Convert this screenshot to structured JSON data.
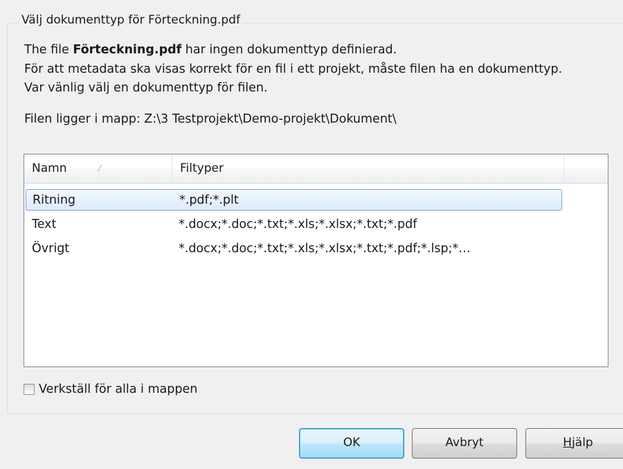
{
  "group": {
    "title": "Välj dokumenttyp för Förteckning.pdf"
  },
  "message": {
    "line1_prefix": "The file ",
    "filename": "Förteckning.pdf",
    "line1_suffix": " har ingen dokumenttyp definierad.",
    "line2": "För att metadata ska visas korrekt för en fil i ett projekt, måste filen ha en dokumenttyp.",
    "line3": "Var vänlig välj en dokumenttyp för filen.",
    "folder": "Filen ligger i mapp:  Z:\\3 Testprojekt\\Demo-projekt\\Dokument\\"
  },
  "list": {
    "columns": {
      "namn": "Namn",
      "filtyper": "Filtyper"
    },
    "sort_indicator": "⁄",
    "rows": [
      {
        "namn": "Ritning",
        "filtyper": "*.pdf;*.plt",
        "selected": true
      },
      {
        "namn": "Text",
        "filtyper": "*.docx;*.doc;*.txt;*.xls;*.xlsx;*.txt;*.pdf",
        "selected": false
      },
      {
        "namn": "Övrigt",
        "filtyper": "*.docx;*.doc;*.txt;*.xls;*.xlsx;*.txt;*.pdf;*.lsp;*…",
        "selected": false
      }
    ]
  },
  "checkbox": {
    "label": "Verkställ för alla i mappen",
    "checked": false
  },
  "buttons": {
    "ok": "OK",
    "cancel": "Avbryt",
    "help_mnemonic": "H",
    "help_rest": "jälp"
  }
}
